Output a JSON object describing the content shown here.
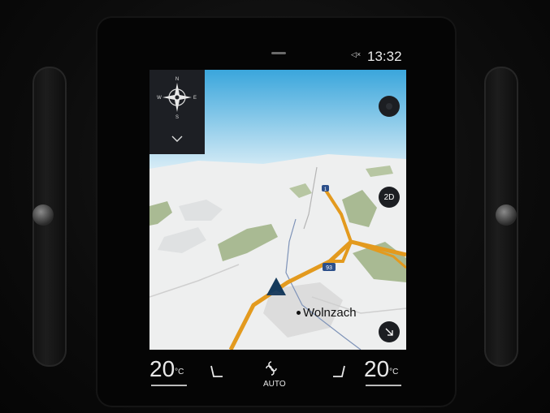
{
  "status": {
    "time": "13:32",
    "volume_icon": "speaker-muted-icon"
  },
  "map": {
    "compass_letters": {
      "north": "N",
      "south": "S",
      "east": "E",
      "west": "W"
    },
    "view_mode": "2D",
    "road_shields": [
      "1",
      "93"
    ],
    "place_label": "Wolnzach"
  },
  "climate": {
    "left_temp": "20",
    "right_temp": "20",
    "unit": "°C",
    "fan_mode": "AUTO"
  },
  "colors": {
    "sky_top": "#3aa6dc",
    "sky_bottom": "#cfe8f4",
    "road_major": "#e39a1e",
    "map_green": "#a6b98f"
  }
}
